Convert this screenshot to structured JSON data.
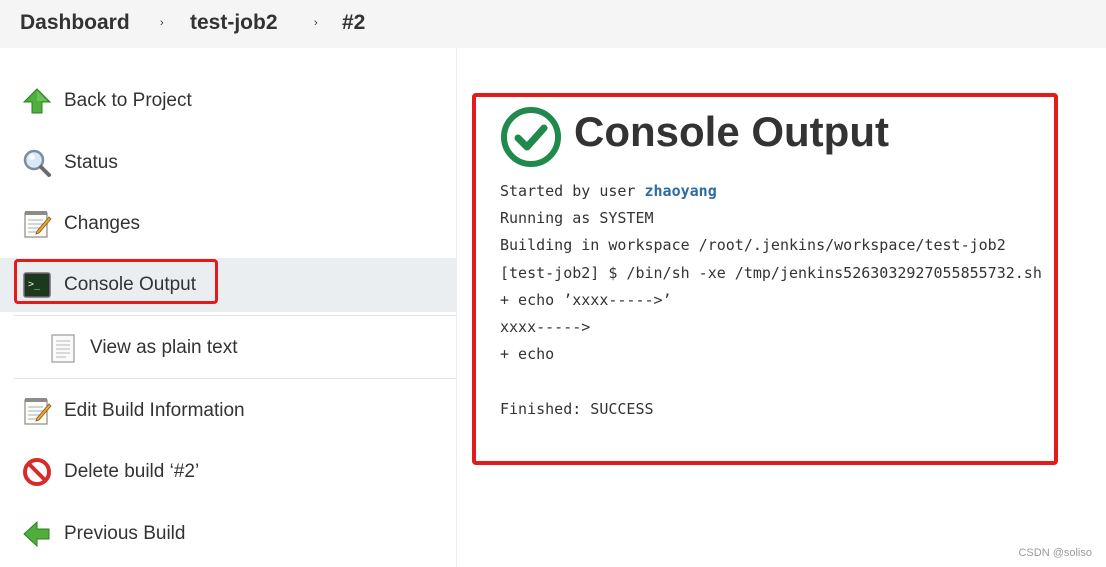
{
  "breadcrumb": {
    "items": [
      "Dashboard",
      "test-job2",
      "#2"
    ],
    "separator": "›"
  },
  "sidebar": {
    "items": [
      {
        "label": "Back to Project",
        "icon": "up-arrow-icon"
      },
      {
        "label": "Status",
        "icon": "magnifier-icon"
      },
      {
        "label": "Changes",
        "icon": "notepad-icon"
      },
      {
        "label": "Console Output",
        "icon": "terminal-icon",
        "active": true
      },
      {
        "label": "View as plain text",
        "icon": "document-icon"
      },
      {
        "label": "Edit Build Information",
        "icon": "notepad-icon"
      },
      {
        "label": "Delete build ‘#2’",
        "icon": "no-entry-icon"
      },
      {
        "label": "Previous Build",
        "icon": "left-arrow-icon"
      }
    ]
  },
  "main": {
    "title": "Console Output",
    "status_icon": "success-check-icon",
    "console": {
      "line1_prefix": "Started by user ",
      "line1_user": "zhaoyang",
      "lines": [
        "Running as SYSTEM",
        "Building in workspace /root/.jenkins/workspace/test-job2",
        "[test-job2] $ /bin/sh -xe /tmp/jenkins5263032927055855732.sh",
        "+ echo ’xxxx----->’",
        "xxxx----->",
        "+ echo",
        "",
        "Finished: SUCCESS"
      ]
    }
  },
  "watermark": "CSDN @soliso",
  "colors": {
    "highlight": "#e31b1b",
    "success": "#1f8a4c",
    "link": "#2c6aa8",
    "active_bg": "#eaeef1"
  }
}
